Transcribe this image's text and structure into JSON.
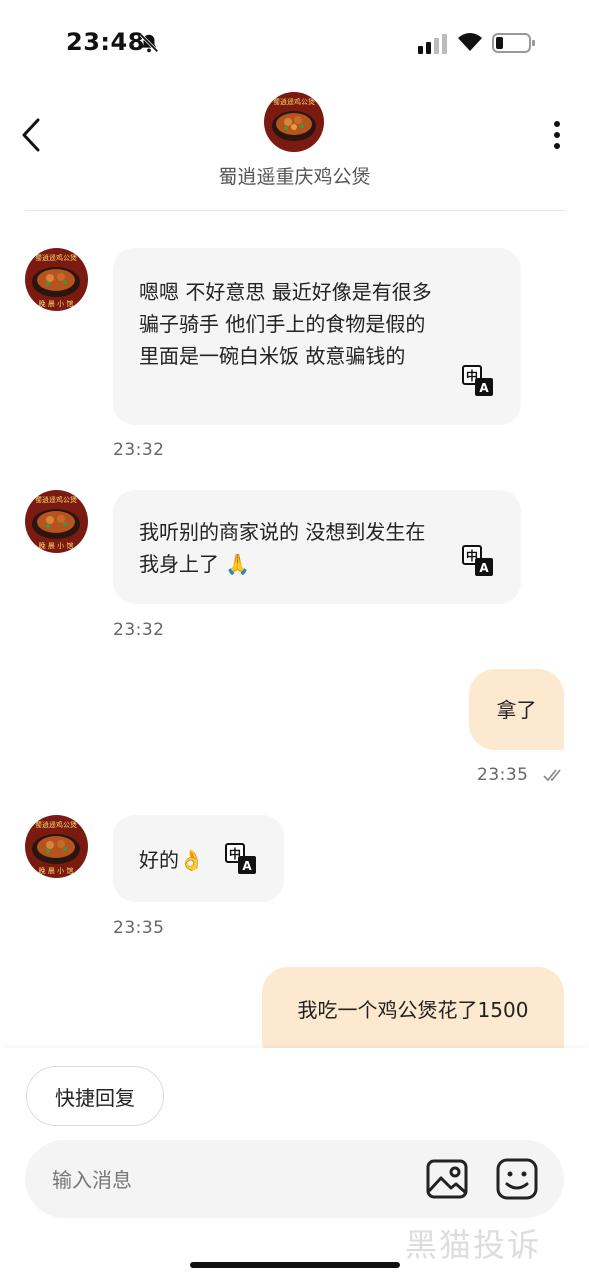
{
  "status_bar": {
    "time": "23:48"
  },
  "header": {
    "title": "蜀逍遥重庆鸡公煲"
  },
  "avatar_text": {
    "top": "蜀逍遥鸡公煲",
    "bottom": "晚 晨 小 馆"
  },
  "messages": [
    {
      "text": "嗯嗯 不好意思 最近好像是有很多骗子骑手 他们手上的食物是假的 里面是一碗白米饭  故意骗钱的",
      "time": "23:32"
    },
    {
      "text": "我听别的商家说的 没想到发生在我身上了 🙏",
      "time": "23:32"
    },
    {
      "text": "拿了",
      "time": "23:35"
    },
    {
      "text": "好的👌",
      "time": "23:35"
    },
    {
      "text": "我吃一个鸡公煲花了1500"
    }
  ],
  "translate_glyphs": {
    "top": "中",
    "bottom": "A"
  },
  "quick_reply": {
    "label": "快捷回复"
  },
  "input": {
    "placeholder": "输入消息"
  },
  "watermark": "黑猫投诉",
  "colors": {
    "incoming_bubble": "#f5f5f5",
    "outgoing_bubble": "#fde9cf"
  }
}
